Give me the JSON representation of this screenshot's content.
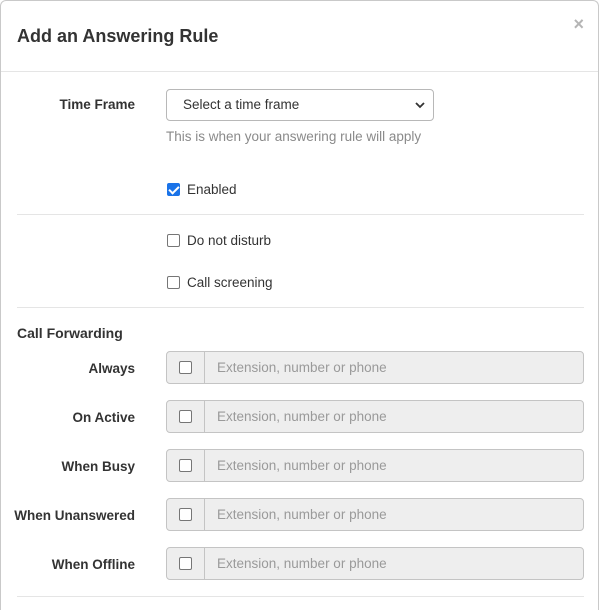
{
  "modal": {
    "title": "Add an Answering Rule",
    "close_label": "×"
  },
  "time_frame": {
    "label": "Time Frame",
    "selected": "Select a time frame",
    "help": "This is when your answering rule will apply"
  },
  "enabled": {
    "label": "Enabled",
    "checked": true
  },
  "do_not_disturb": {
    "label": "Do not disturb",
    "checked": false
  },
  "call_screening": {
    "label": "Call screening",
    "checked": false
  },
  "call_forwarding": {
    "title": "Call Forwarding",
    "rows": [
      {
        "label": "Always",
        "placeholder": "Extension, number or phone",
        "checked": false
      },
      {
        "label": "On Active",
        "placeholder": "Extension, number or phone",
        "checked": false
      },
      {
        "label": "When Busy",
        "placeholder": "Extension, number or phone",
        "checked": false
      },
      {
        "label": "When Unanswered",
        "placeholder": "Extension, number or phone",
        "checked": false
      },
      {
        "label": "When Offline",
        "placeholder": "Extension, number or phone",
        "checked": false
      }
    ]
  },
  "colors": {
    "checkbox_accent": "#1a73e8",
    "input_addon_bg": "#eeeeee",
    "help_text": "#8a8a8a"
  }
}
